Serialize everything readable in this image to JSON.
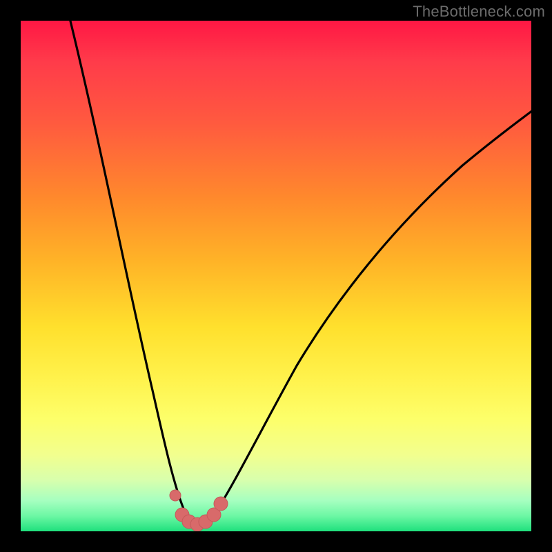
{
  "watermark": "TheBottleneck.com",
  "colors": {
    "frame": "#000000",
    "curve_stroke": "#000000",
    "marker_fill": "#d86a6a",
    "marker_stroke": "#c45a5a"
  },
  "chart_data": {
    "type": "line",
    "title": "",
    "xlabel": "",
    "ylabel": "",
    "xlim": [
      0,
      100
    ],
    "ylim": [
      0,
      100
    ],
    "grid": false,
    "legend": false,
    "series": [
      {
        "name": "bottleneck-curve",
        "x": [
          0,
          5,
          10,
          15,
          20,
          24,
          27,
          30,
          32,
          34,
          36,
          40,
          45,
          50,
          55,
          60,
          65,
          70,
          75,
          80,
          85,
          90,
          95,
          100
        ],
        "values": [
          125,
          105,
          86,
          68,
          50,
          33,
          20,
          10,
          4,
          1,
          1,
          4,
          12,
          22,
          32,
          41,
          49,
          56,
          62,
          67,
          72,
          76,
          80,
          83
        ]
      }
    ],
    "markers": {
      "name": "bottom-sweet-spot",
      "x": [
        30.5,
        31.5,
        32.5,
        33.5,
        34.5,
        35.5,
        36.5
      ],
      "values": [
        7,
        2,
        1,
        1,
        1,
        2,
        4
      ]
    },
    "background_gradient": "vertical red→orange→yellow→green"
  }
}
